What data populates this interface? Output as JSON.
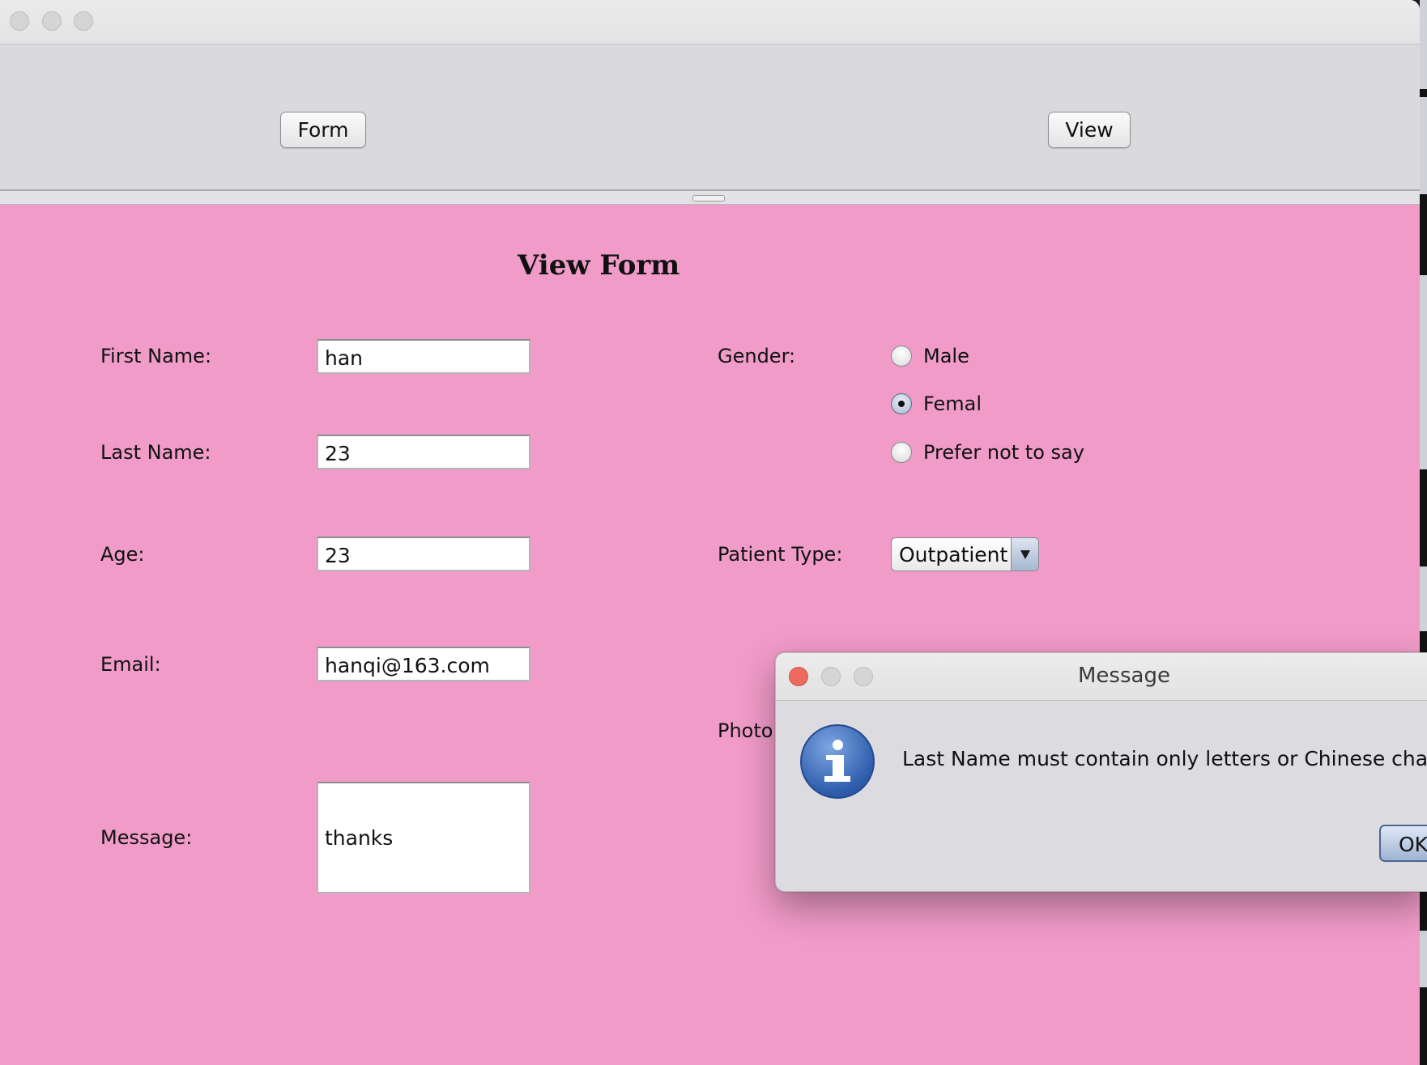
{
  "window": {
    "traffic_lights": [
      "close",
      "minimize",
      "zoom"
    ]
  },
  "toolbar": {
    "form_label": "Form",
    "view_label": "View"
  },
  "form": {
    "title": "View Form",
    "first_name": {
      "label": "First Name:",
      "value": "han"
    },
    "last_name": {
      "label": "Last Name:",
      "value": "23"
    },
    "age": {
      "label": "Age:",
      "value": "23"
    },
    "email": {
      "label": "Email:",
      "value": "hanqi@163.com"
    },
    "message": {
      "label": "Message:",
      "value": "thanks"
    },
    "gender": {
      "label": "Gender:",
      "options": [
        {
          "label": "Male",
          "selected": false
        },
        {
          "label": "Femal",
          "selected": true
        },
        {
          "label": "Prefer not to say",
          "selected": false
        }
      ]
    },
    "patient_type": {
      "label": "Patient Type:",
      "selected": "Outpatient"
    },
    "photo": {
      "label": "Photo"
    }
  },
  "dialog": {
    "title": "Message",
    "icon": "info-icon",
    "message": "Last Name must contain only letters or Chinese characte",
    "ok_label": "OK"
  },
  "colors": {
    "form_background": "#f09bc8",
    "window_background": "#d9d9de",
    "close_red": "#ec6a5e",
    "info_blue": "#2e5cab"
  }
}
